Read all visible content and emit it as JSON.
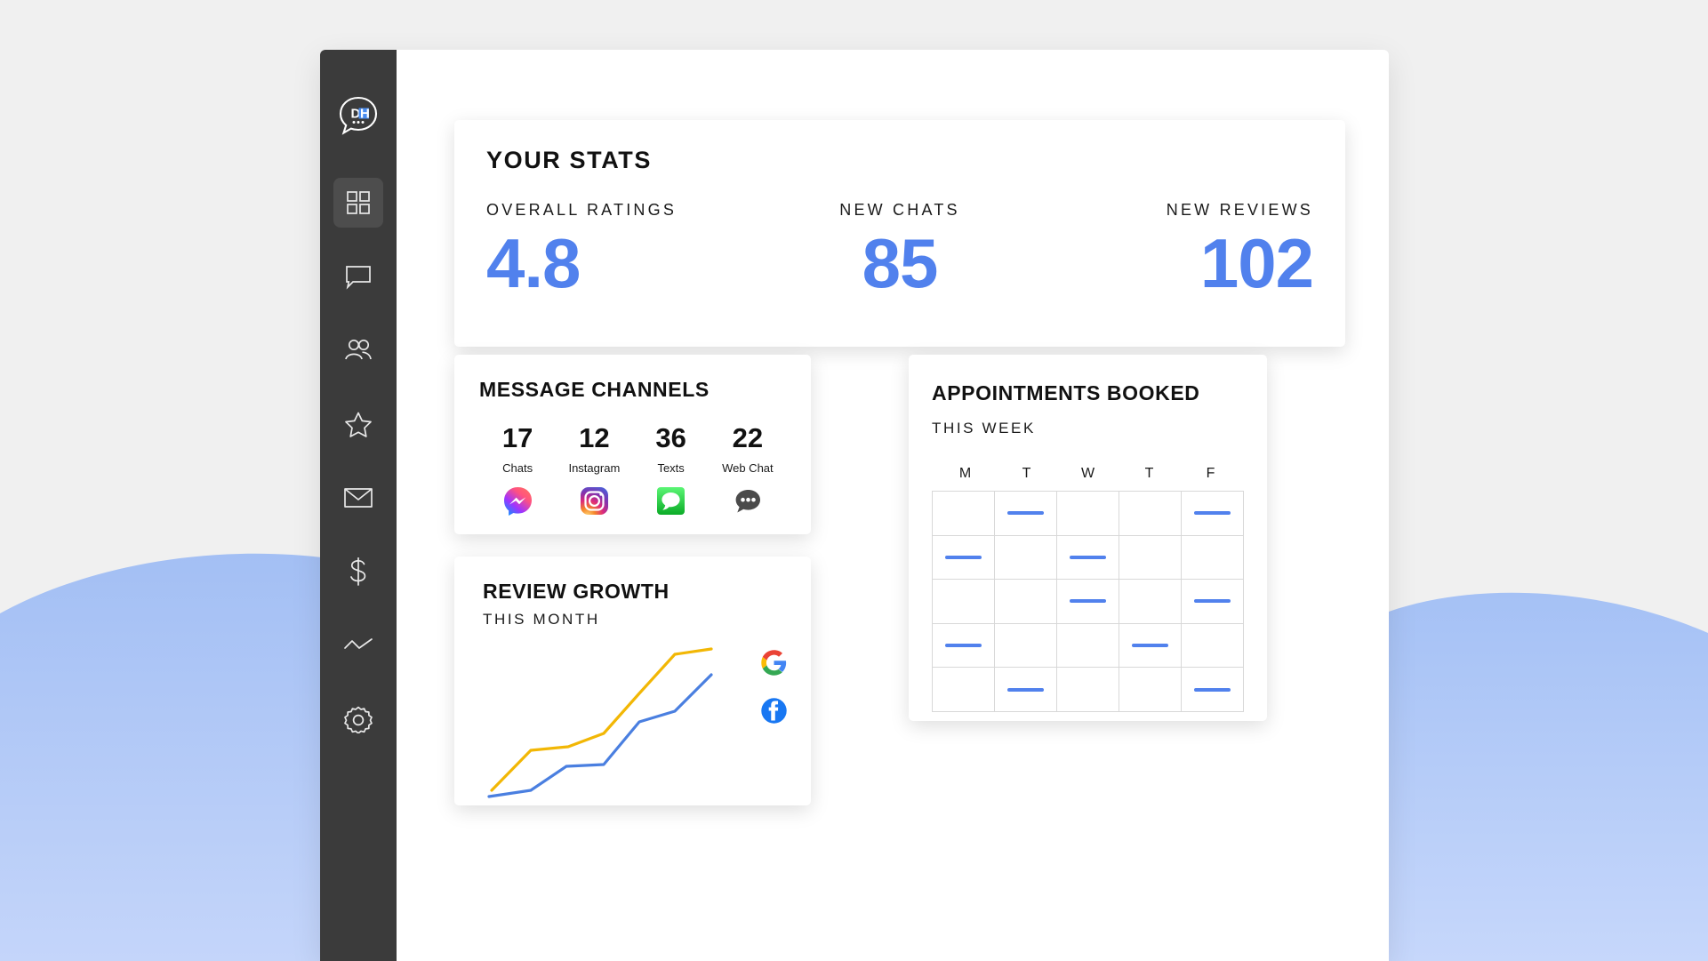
{
  "theme": {
    "accent_blue": "#5181ed",
    "wave_blue": "#a8c2f5",
    "page_bg": "#f0f0f0",
    "sidebar_bg": "#3b3b3b",
    "panel_bg": "#ffffff",
    "google_yellow": "#f2b705",
    "facebook_blue": "#1877f2"
  },
  "sidebar": {
    "logo": {
      "name": "dh-logo",
      "initials_left": "D",
      "initials_right": "H"
    },
    "items": [
      {
        "label": "Dashboard",
        "icon": "grid-icon",
        "active": true
      },
      {
        "label": "Messages",
        "icon": "chat-bubble-icon",
        "active": false
      },
      {
        "label": "Contacts",
        "icon": "people-icon",
        "active": false
      },
      {
        "label": "Reviews",
        "icon": "star-icon",
        "active": false
      },
      {
        "label": "Email",
        "icon": "envelope-icon",
        "active": false
      },
      {
        "label": "Payments",
        "icon": "dollar-icon",
        "active": false
      },
      {
        "label": "Analytics",
        "icon": "line-chart-icon",
        "active": false
      },
      {
        "label": "Settings",
        "icon": "gear-icon",
        "active": false
      }
    ]
  },
  "stats_card": {
    "title": "YOUR STATS",
    "metrics": [
      {
        "label": "OVERALL RATINGS",
        "value": "4.8"
      },
      {
        "label": "NEW CHATS",
        "value": "85"
      },
      {
        "label": "NEW REVIEWS",
        "value": "102"
      }
    ]
  },
  "channels_card": {
    "title": "MESSAGE CHANNELS",
    "channels": [
      {
        "count": "17",
        "name": "Chats",
        "icon": "messenger-icon"
      },
      {
        "count": "12",
        "name": "Instagram",
        "icon": "instagram-icon"
      },
      {
        "count": "36",
        "name": "Texts",
        "icon": "imessage-icon"
      },
      {
        "count": "22",
        "name": "Web Chat",
        "icon": "webchat-bubble-icon"
      }
    ]
  },
  "review_card": {
    "title": "REVIEW GROWTH",
    "subtitle": "THIS MONTH",
    "legend": [
      {
        "name": "Google",
        "icon": "google-icon",
        "color": "#f2b705"
      },
      {
        "name": "Facebook",
        "icon": "facebook-icon",
        "color": "#4a7fe0"
      }
    ]
  },
  "appointments_card": {
    "title": "APPOINTMENTS BOOKED",
    "subtitle": "THIS WEEK",
    "day_headers": [
      "M",
      "T",
      "W",
      "T",
      "F"
    ],
    "slots": [
      [
        false,
        true,
        false,
        false,
        true
      ],
      [
        true,
        false,
        true,
        false,
        false
      ],
      [
        false,
        false,
        true,
        false,
        true
      ],
      [
        true,
        false,
        false,
        true,
        false
      ],
      [
        false,
        true,
        false,
        false,
        true
      ]
    ]
  },
  "chart_data": {
    "type": "line",
    "title": "REVIEW GROWTH",
    "subtitle": "THIS MONTH",
    "xlabel": "",
    "ylabel": "",
    "grid": false,
    "legend_position": "right",
    "x": [
      0,
      1,
      2,
      3,
      4,
      5,
      6,
      7
    ],
    "series": [
      {
        "name": "Google",
        "color": "#f2b705",
        "values": [
          8,
          30,
          33,
          42,
          62,
          85,
          90,
          96
        ]
      },
      {
        "name": "Facebook",
        "color": "#4a7fe0",
        "values": [
          2,
          8,
          22,
          24,
          40,
          56,
          68,
          80
        ]
      }
    ],
    "ylim": [
      0,
      100
    ],
    "xlim": [
      0,
      7
    ]
  }
}
